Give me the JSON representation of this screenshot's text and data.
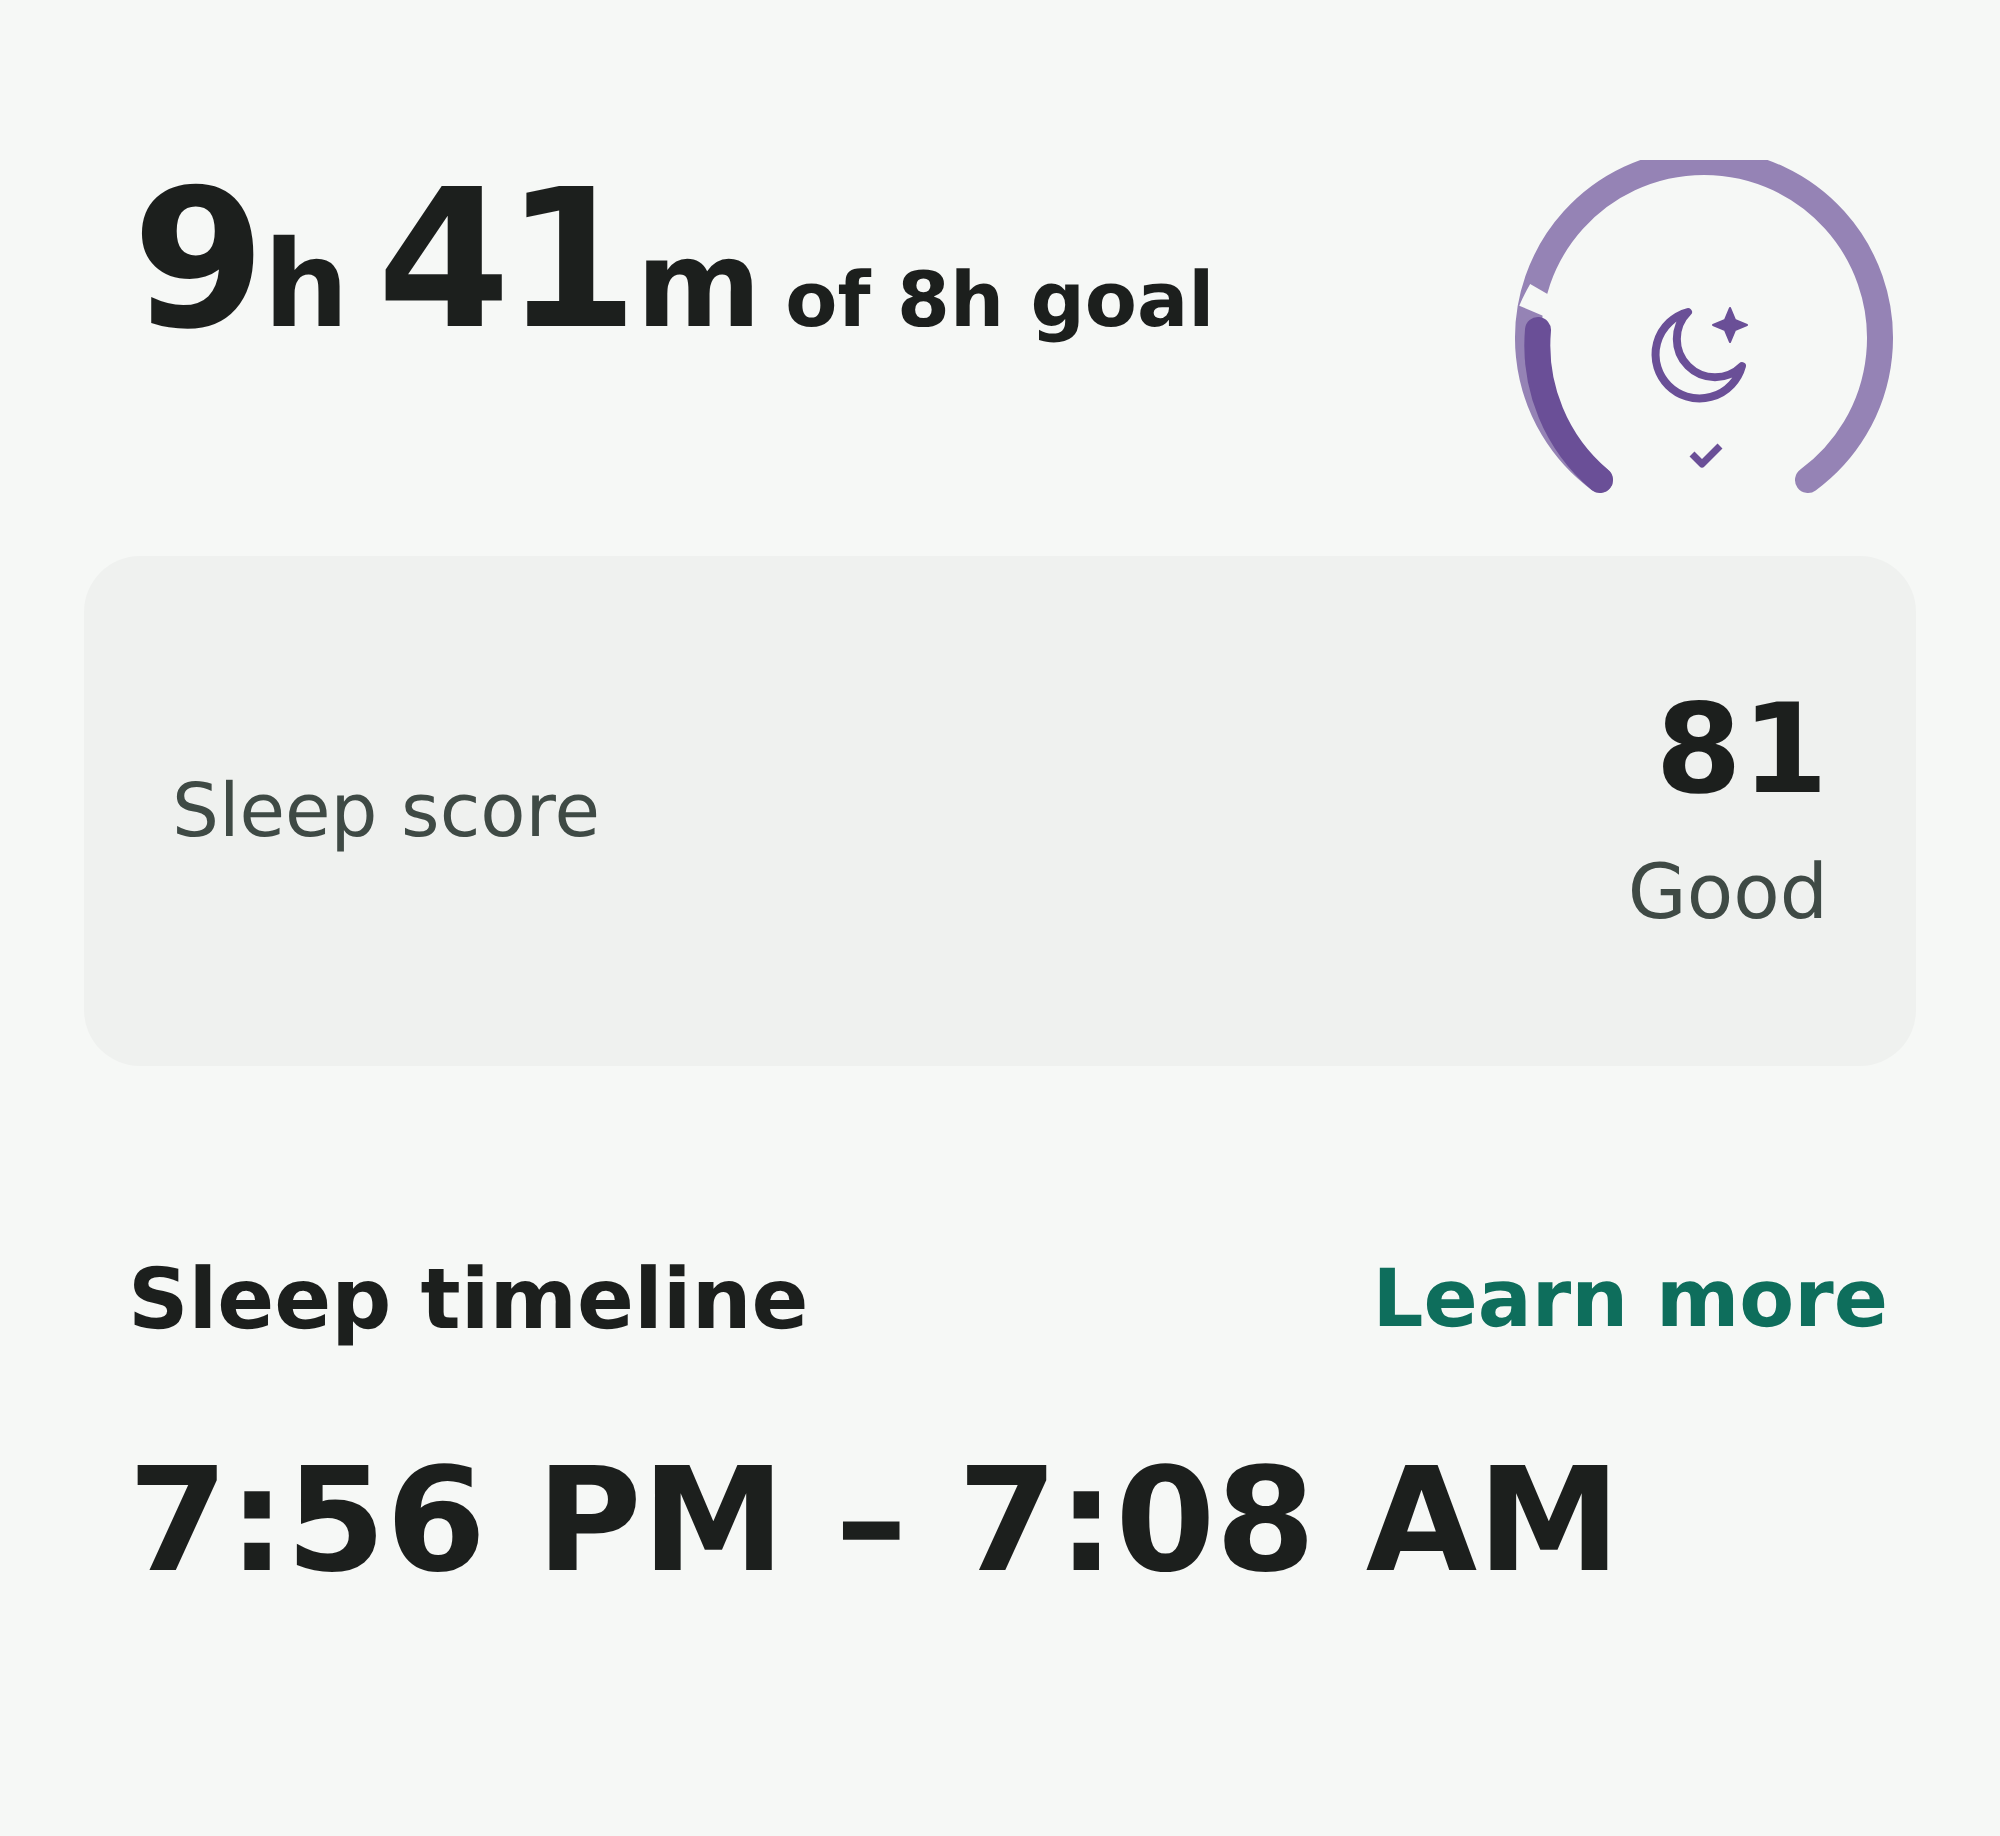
{
  "duration": {
    "hours": "9",
    "hours_unit": "h",
    "minutes": "41",
    "minutes_unit": "m",
    "goal": "of 8h goal"
  },
  "sleep_score": {
    "label": "Sleep score",
    "value": "81",
    "rating": "Good"
  },
  "timeline": {
    "title": "Sleep timeline",
    "link": "Learn more",
    "range": "7:56 PM – 7:08 AM"
  }
}
